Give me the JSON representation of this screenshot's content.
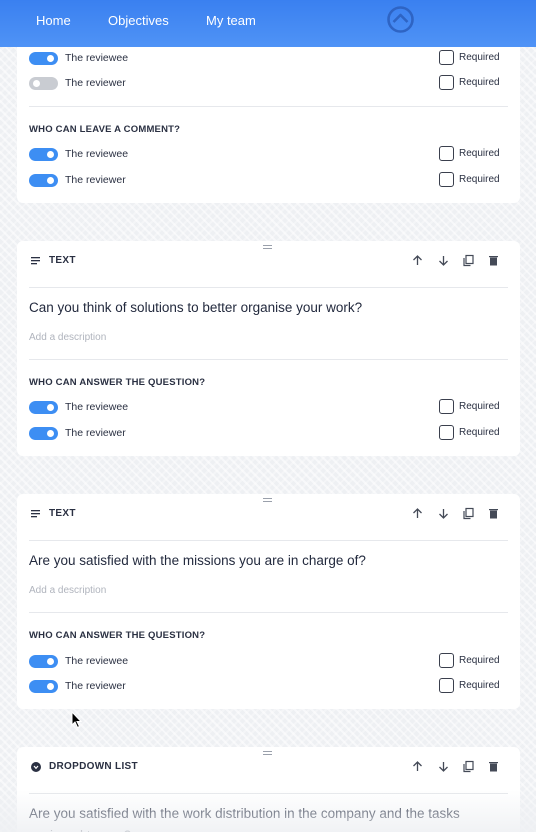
{
  "nav": {
    "items": [
      "Home",
      "Objectives",
      "My team"
    ]
  },
  "colors": {
    "accent": "#3d8ef3",
    "nav": "#3a80f0"
  },
  "card0": {
    "rows": [
      {
        "label": "The reviewee",
        "toggle_on": true,
        "required_label": "Required",
        "required_checked": false
      },
      {
        "label": "The reviewer",
        "toggle_on": false,
        "required_label": "Required",
        "required_checked": false
      }
    ],
    "comment_title": "WHO CAN LEAVE A COMMENT?",
    "comment_rows": [
      {
        "label": "The reviewee",
        "toggle_on": true,
        "required_label": "Required",
        "required_checked": false
      },
      {
        "label": "The reviewer",
        "toggle_on": true,
        "required_label": "Required",
        "required_checked": false
      }
    ]
  },
  "blocks": [
    {
      "type_label": "TEXT",
      "type_icon": "text-lines-icon",
      "question": "Can you think of solutions to better organise your work?",
      "description_placeholder": "Add a description",
      "answer_title": "WHO CAN ANSWER THE QUESTION?",
      "rows": [
        {
          "label": "The reviewee",
          "toggle_on": true,
          "required_label": "Required",
          "required_checked": false
        },
        {
          "label": "The reviewer",
          "toggle_on": true,
          "required_label": "Required",
          "required_checked": false
        }
      ]
    },
    {
      "type_label": "TEXT",
      "type_icon": "text-lines-icon",
      "question": "Are you satisfied with the missions you are in charge of?",
      "description_placeholder": "Add a description",
      "answer_title": "WHO CAN ANSWER THE QUESTION?",
      "rows": [
        {
          "label": "The reviewee",
          "toggle_on": true,
          "required_label": "Required",
          "required_checked": false
        },
        {
          "label": "The reviewer",
          "toggle_on": true,
          "required_label": "Required",
          "required_checked": false
        }
      ]
    },
    {
      "type_label": "DROPDOWN LIST",
      "type_icon": "dropdown-circle-icon",
      "question": "Are you satisfied with the work distribution in the company and the tasks assigned to you?"
    }
  ],
  "tool_icons": [
    "arrow-up-icon",
    "arrow-down-icon",
    "duplicate-icon",
    "trash-icon"
  ]
}
